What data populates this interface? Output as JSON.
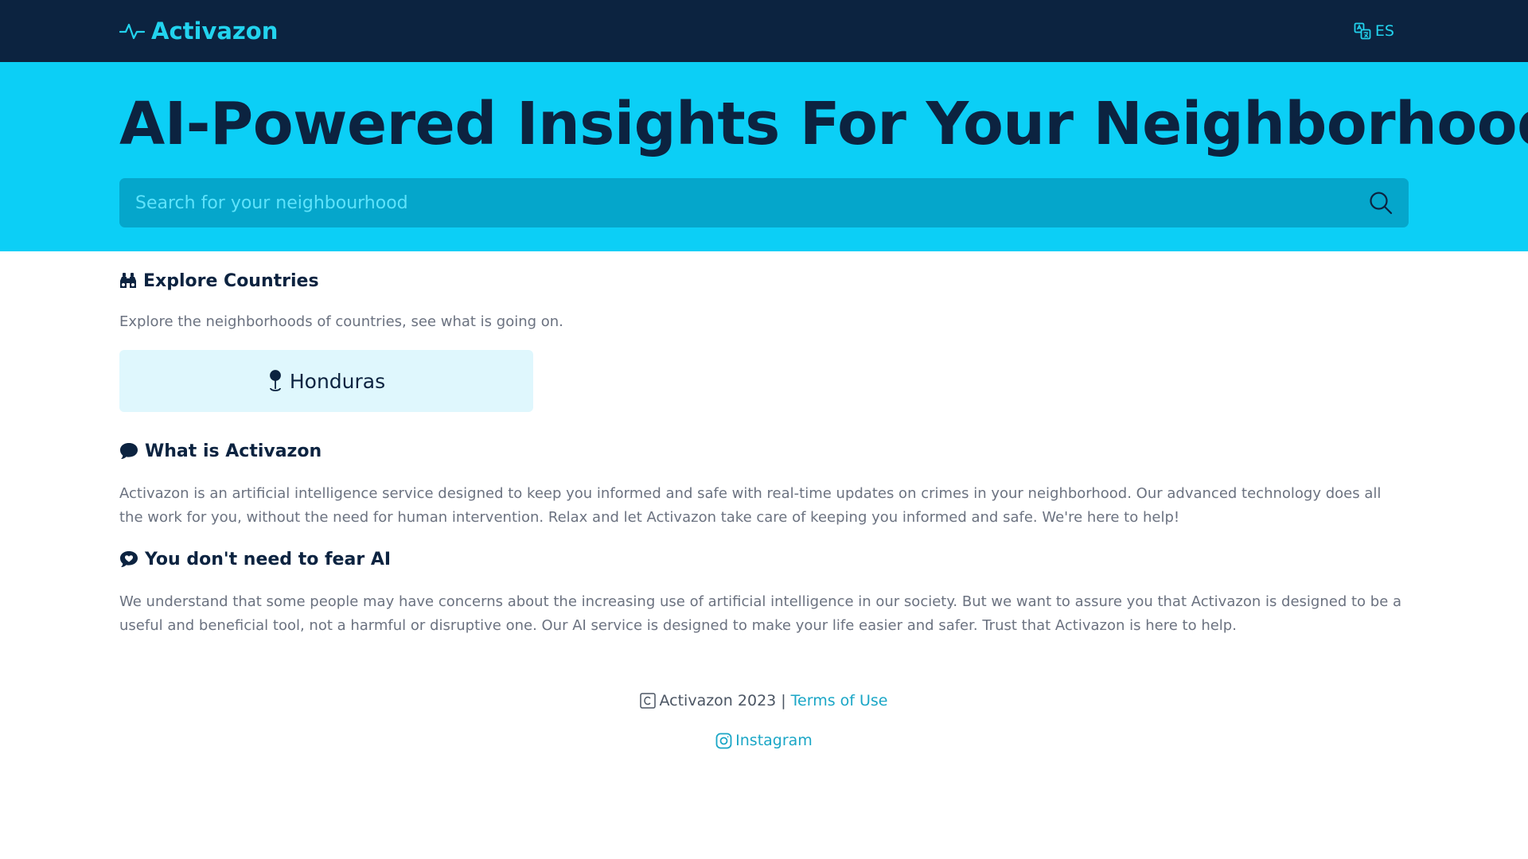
{
  "nav": {
    "brand": "Activazon",
    "brand_icon": "activity-pulse-icon",
    "language_label": "ES",
    "language_icon": "translate-icon"
  },
  "hero": {
    "title": "AI-Powered Insights For Your Neighborhood"
  },
  "search": {
    "placeholder": "Search for your neighbourhood",
    "value": "",
    "icon": "search-icon"
  },
  "explore": {
    "heading": "Explore Countries",
    "heading_icon": "binoculars-icon",
    "description": "Explore the neighborhoods of countries, see what is going on.",
    "countries": [
      {
        "name": "Honduras",
        "icon": "map-pin-icon"
      }
    ]
  },
  "about": {
    "heading": "What is Activazon",
    "heading_icon": "chat-bubble-icon",
    "text": "Activazon is an artificial intelligence service designed to keep you informed and safe with real-time updates on crimes in your neighborhood. Our advanced technology does all the work for you, without the need for human intervention. Relax and let Activazon take care of keeping you informed and safe. We're here to help!"
  },
  "fear": {
    "heading": "You don't need to fear AI",
    "heading_icon": "chat-heart-icon",
    "text": "We understand that some people may have concerns about the increasing use of artificial intelligence in our society. But we want to assure you that Activazon is designed to be a useful and beneficial tool, not a harmful or disruptive one. Our AI service is designed to make your life easier and safer. Trust that Activazon is here to help."
  },
  "footer": {
    "copyright": "Activazon 2023",
    "separator": "|",
    "terms_label": "Terms of Use",
    "instagram_label": "Instagram"
  },
  "colors": {
    "nav_bg": "#0c2340",
    "accent": "#22d3ee",
    "hero_bg": "#0ccff6",
    "search_bg": "#05a6cb",
    "card_bg": "#dff7fd",
    "link": "#1aa6c6",
    "body_text": "#6b7280"
  }
}
